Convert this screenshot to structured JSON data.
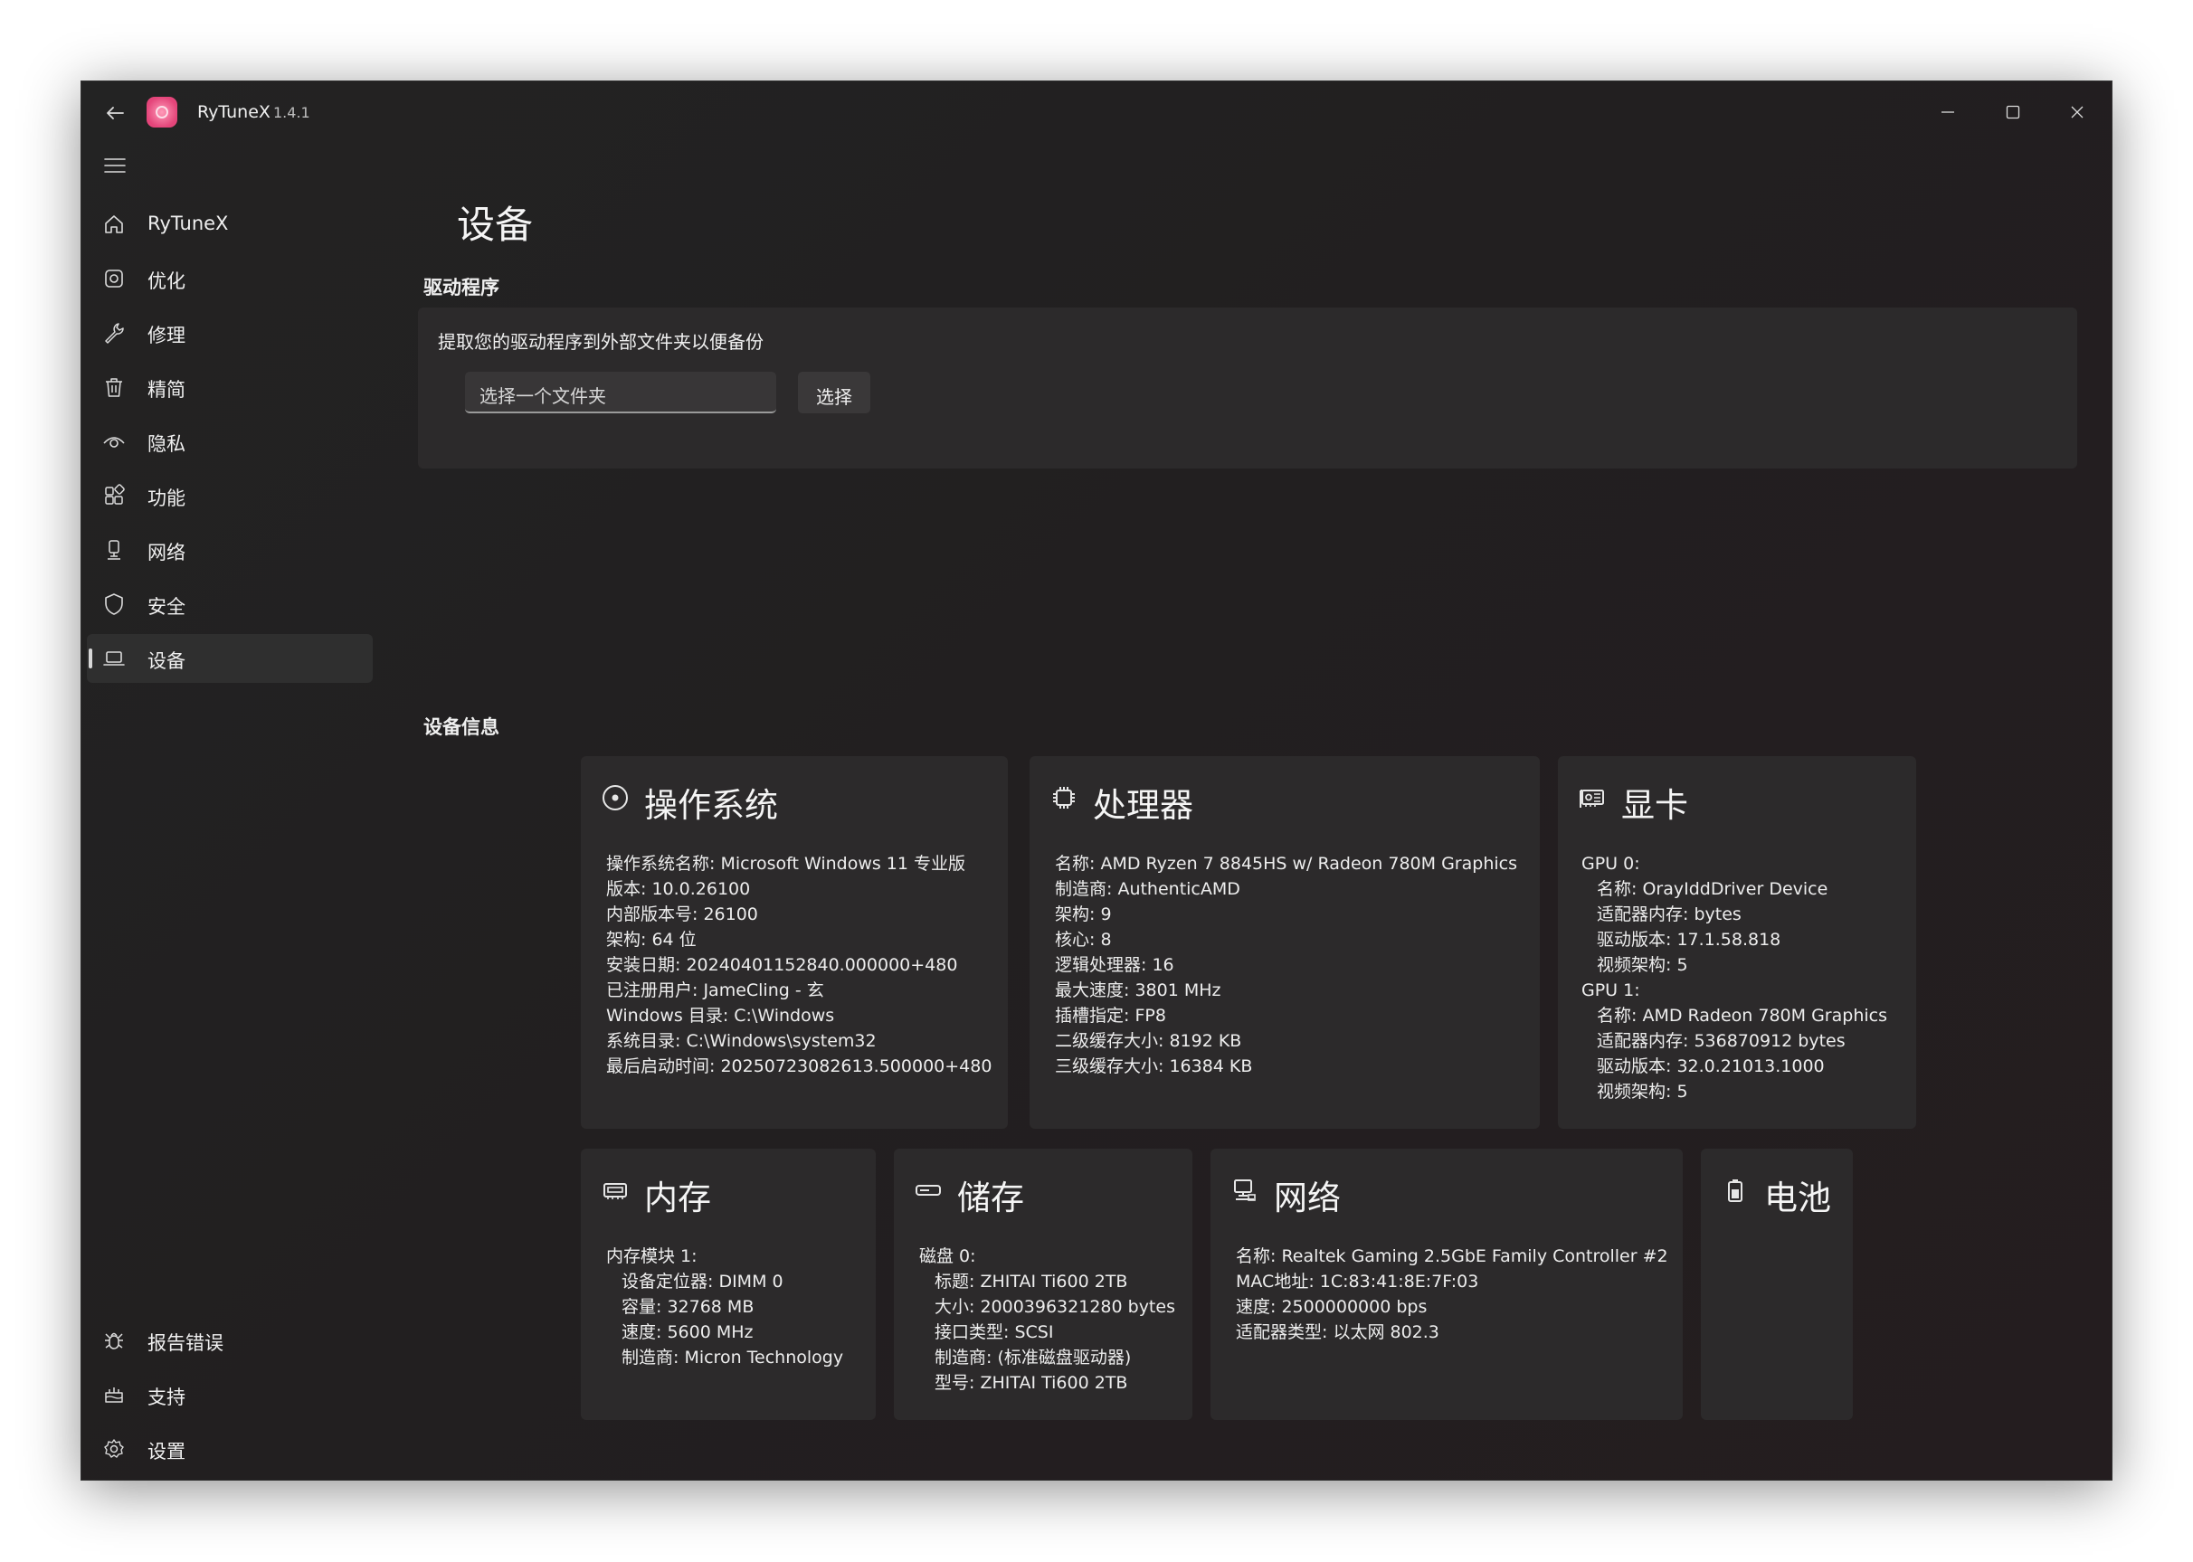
{
  "app": {
    "name": "RyTuneX",
    "version": "1.4.1"
  },
  "sidebar": {
    "items": [
      {
        "label": "RyTuneX",
        "icon": "home-icon"
      },
      {
        "label": "优化",
        "icon": "optimize-icon"
      },
      {
        "label": "修理",
        "icon": "wrench-icon"
      },
      {
        "label": "精简",
        "icon": "trash-icon"
      },
      {
        "label": "隐私",
        "icon": "eye-icon"
      },
      {
        "label": "功能",
        "icon": "apps-icon"
      },
      {
        "label": "网络",
        "icon": "network-icon"
      },
      {
        "label": "安全",
        "icon": "shield-icon"
      },
      {
        "label": "设备",
        "icon": "laptop-icon",
        "active": true
      }
    ],
    "bottom_items": [
      {
        "label": "报告错误",
        "icon": "bug-icon"
      },
      {
        "label": "支持",
        "icon": "support-icon"
      },
      {
        "label": "设置",
        "icon": "gear-icon"
      }
    ]
  },
  "page": {
    "title": "设备",
    "drivers": {
      "section_label": "驱动程序",
      "description": "提取您的驱动程序到外部文件夹以便备份",
      "folder_placeholder": "选择一个文件夹",
      "select_button": "选择"
    },
    "device_info": {
      "section_label": "设备信息",
      "os": {
        "title": "操作系统",
        "lines": [
          "操作系统名称: Microsoft Windows 11 专业版",
          "版本: 10.0.26100",
          "内部版本号: 26100",
          "架构: 64 位",
          "安装日期: 20240401152840.000000+480",
          "已注册用户: JameCling - 玄",
          "Windows 目录: C:\\Windows",
          "系统目录: C:\\Windows\\system32",
          "最后启动时间: 20250723082613.500000+480"
        ]
      },
      "cpu": {
        "title": "处理器",
        "lines": [
          "名称: AMD Ryzen 7 8845HS w/ Radeon 780M Graphics",
          "制造商: AuthenticAMD",
          "架构: 9",
          "核心: 8",
          "逻辑处理器: 16",
          "最大速度: 3801 MHz",
          "插槽指定: FP8",
          "二级缓存大小: 8192 KB",
          "三级缓存大小: 16384 KB"
        ]
      },
      "gpu": {
        "title": "显卡",
        "lines": [
          "GPU 0:",
          "名称: OrayIddDriver Device",
          "适配器内存:  bytes",
          "驱动版本: 17.1.58.818",
          "视频架构: 5",
          "GPU 1:",
          "名称: AMD Radeon 780M Graphics",
          "适配器内存: 536870912 bytes",
          "驱动版本: 32.0.21013.1000",
          "视频架构: 5"
        ]
      },
      "memory": {
        "title": "内存",
        "lines": [
          "内存模块 1:",
          "设备定位器: DIMM 0",
          "容量: 32768 MB",
          "速度: 5600 MHz",
          "制造商: Micron Technology"
        ]
      },
      "storage": {
        "title": "储存",
        "lines": [
          "磁盘 0:",
          "标题: ZHITAI Ti600 2TB",
          "大小: 2000396321280 bytes",
          "接口类型: SCSI",
          "制造商: (标准磁盘驱动器)",
          "型号: ZHITAI Ti600 2TB"
        ]
      },
      "network": {
        "title": "网络",
        "lines": [
          "名称: Realtek Gaming 2.5GbE Family Controller #2",
          "MAC地址: 1C:83:41:8E:7F:03",
          "速度: 2500000000 bps",
          "适配器类型: 以太网 802.3"
        ]
      },
      "battery": {
        "title": "电池"
      }
    }
  }
}
